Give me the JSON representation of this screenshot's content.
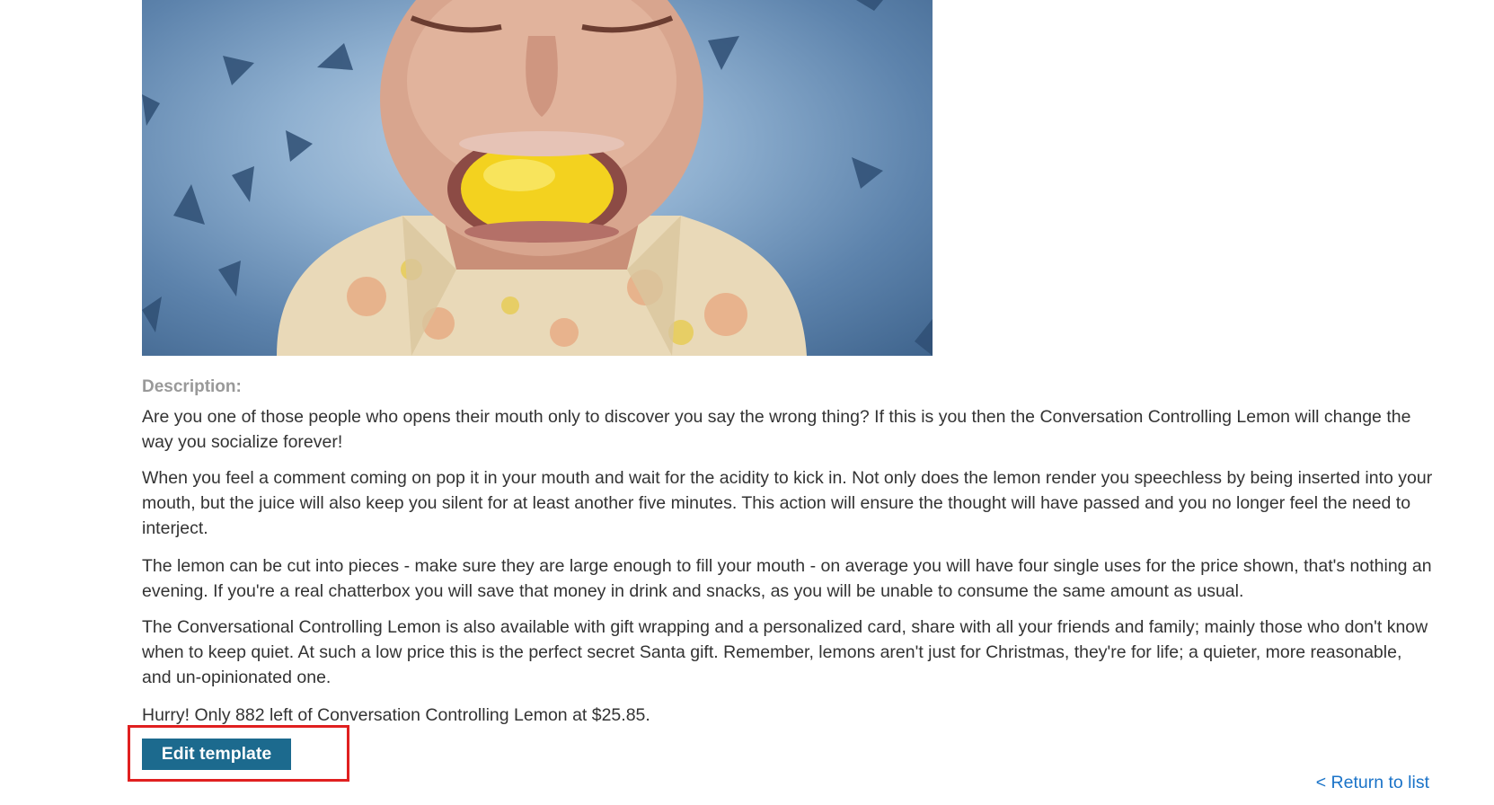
{
  "product": {
    "image_alt": "Conversation Controlling Lemon",
    "description_label": "Description:",
    "paragraphs": [
      "Are you one of those people who opens their mouth only to discover you say the wrong thing? If this is you then the Conversation Controlling Lemon will change the way you socialize forever!",
      "When you feel a comment coming on pop it in your mouth and wait for the acidity to kick in. Not only does the lemon render you speechless by being inserted into your mouth, but the juice will also keep you silent for at least another five minutes. This action will ensure the thought will have passed and you no longer feel the need to interject.",
      "The lemon can be cut into pieces - make sure they are large enough to fill your mouth - on average you will have four single uses for the price shown, that's nothing an evening. If you're a real chatterbox you will save that money in drink and snacks, as you will be unable to consume the same amount as usual.",
      "The Conversational Controlling Lemon is also available with gift wrapping and a personalized card, share with all your friends and family; mainly those who don't know when to keep quiet. At such a low price this is the perfect secret Santa gift. Remember, lemons aren't just for Christmas, they're for life; a quieter, more reasonable, and un-opinionated one."
    ],
    "stock_text": "Hurry! Only 882 left of Conversation Controlling Lemon at $25.85."
  },
  "actions": {
    "edit_template_label": "Edit template",
    "return_link_label": "< Return to list"
  },
  "colors": {
    "button_bg": "#1c6a8e",
    "link": "#1a73c8",
    "highlight": "#e02020",
    "label": "#999999"
  }
}
